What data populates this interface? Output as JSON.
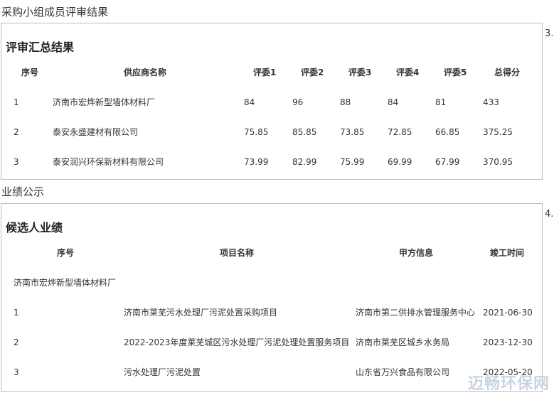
{
  "section1_label": "采购小组成员评审结果",
  "section1_side_num": "3.",
  "review": {
    "title": "评审汇总结果",
    "headers": [
      "序号",
      "供应商名称",
      "评委1",
      "评委2",
      "评委3",
      "评委4",
      "评委5",
      "总得分"
    ],
    "rows": [
      [
        "1",
        "济南市宏烨新型墙体材料厂",
        "84",
        "96",
        "88",
        "84",
        "81",
        "433"
      ],
      [
        "2",
        "泰安永盛建材有限公司",
        "75.85",
        "85.85",
        "73.85",
        "72.85",
        "66.85",
        "375.25"
      ],
      [
        "3",
        "泰安润兴环保新材料有限公司",
        "73.99",
        "82.99",
        "75.99",
        "69.99",
        "67.99",
        "370.95"
      ]
    ]
  },
  "section2_label": "业绩公示",
  "section2_side_num": "4.",
  "performance": {
    "title": "候选人业绩",
    "headers": [
      "序号",
      "项目名称",
      "甲方信息",
      "竣工时间"
    ],
    "candidate": "济南市宏烨新型墙体材料厂",
    "rows": [
      [
        "1",
        "济南市莱芜污水处理厂污泥处置采购项目",
        "济南市第二供排水管理服务中心",
        "2021-06-30"
      ],
      [
        "2",
        "2022-2023年度莱芜城区污水处理厂污泥处理处置服务项目",
        "济南市莱芜区城乡水务局",
        "2023-12-30"
      ],
      [
        "3",
        "污水处理厂污泥处置",
        "山东省万兴食品有限公司",
        "2022-05-20"
      ]
    ]
  },
  "watermark": "迈畅环保网"
}
